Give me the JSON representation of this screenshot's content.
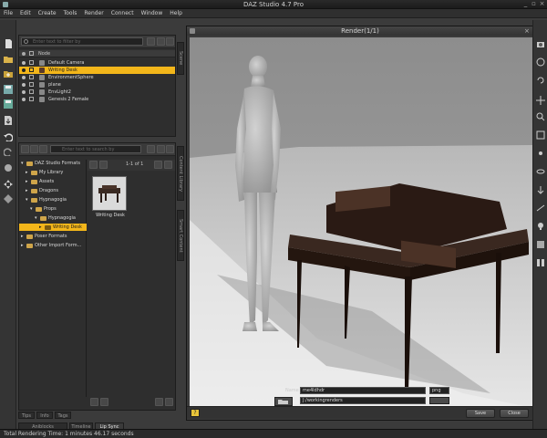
{
  "app": {
    "title": "DAZ Studio 4.7 Pro"
  },
  "menu": [
    "File",
    "Edit",
    "Create",
    "Tools",
    "Render",
    "Connect",
    "Window",
    "Help"
  ],
  "scene_pane": {
    "filter_placeholder": "Enter text to filter by",
    "column_node": "Node",
    "nodes": [
      {
        "label": "Default Camera",
        "icon": "camera-icon",
        "selected": false
      },
      {
        "label": "Writing Desk",
        "icon": "prop-icon",
        "selected": true
      },
      {
        "label": "EnvironmentSphere",
        "icon": "sphere-icon",
        "selected": false
      },
      {
        "label": "plane",
        "icon": "plane-icon",
        "selected": false
      },
      {
        "label": "EnvLight2",
        "icon": "light-icon",
        "selected": false
      },
      {
        "label": "Genesis 2 Female",
        "icon": "figure-icon",
        "selected": false
      }
    ]
  },
  "content_pane": {
    "search_placeholder": "Enter text to search by",
    "page_info": "1-1 of 1",
    "tree": [
      {
        "label": "DAZ Studio Formats",
        "indent": 0,
        "expanded": true,
        "selected": false
      },
      {
        "label": "My Library",
        "indent": 1,
        "expanded": false,
        "selected": false
      },
      {
        "label": "Assets",
        "indent": 1,
        "expanded": false,
        "selected": false
      },
      {
        "label": "Dragons",
        "indent": 1,
        "expanded": false,
        "selected": false
      },
      {
        "label": "Hypnagogia",
        "indent": 1,
        "expanded": true,
        "selected": false
      },
      {
        "label": "Props",
        "indent": 2,
        "expanded": true,
        "selected": false
      },
      {
        "label": "Hypnagogia",
        "indent": 3,
        "expanded": true,
        "selected": false
      },
      {
        "label": "Writing Desk",
        "indent": 4,
        "expanded": false,
        "selected": true
      },
      {
        "label": "Poser Formats",
        "indent": 0,
        "expanded": false,
        "selected": false
      },
      {
        "label": "Other Import Form...",
        "indent": 0,
        "expanded": false,
        "selected": false
      }
    ],
    "thumbnail_label": "Writing Desk",
    "bottom_tabs": [
      "Tips",
      "Info",
      "Tags"
    ]
  },
  "left_side_tabs": [
    "Scene",
    "Content Library",
    "Smart Content"
  ],
  "render_window": {
    "title": "Render(1/1)",
    "name_label": "Name",
    "name_value": "me4ldhdr",
    "format_value": "png",
    "path_value": "J:/workingrenders",
    "save_label": "Save",
    "close_label": "Close"
  },
  "bottom_tabs": [
    "Aniblocks",
    "Timeline",
    "Lip Sync"
  ],
  "status": "Total Rendering Time: 1 minutes 46.17 seconds",
  "colors": {
    "accent": "#f3b61a",
    "background": "#3b3b3b",
    "panel": "#2e2e2e"
  }
}
